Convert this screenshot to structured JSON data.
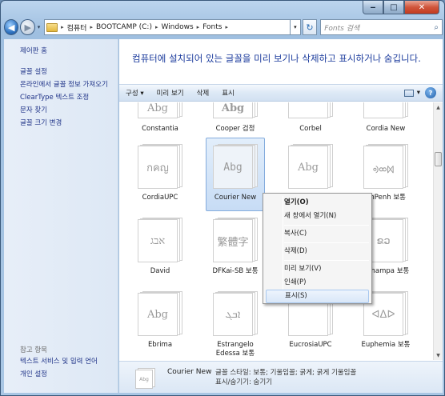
{
  "window": {
    "caption": {
      "minimize": "‒",
      "maximize": "□",
      "close": "✕"
    }
  },
  "nav": {
    "back_icon": "◀",
    "forward_icon": "▶",
    "breadcrumb": [
      "컴퓨터",
      "BOOTCAMP (C:)",
      "Windows",
      "Fonts"
    ],
    "search_placeholder": "Fonts 검색"
  },
  "left_pane": {
    "home": "제어판 홈",
    "links": [
      "글꼴 설정",
      "온라인에서 글꼴 정보 가져오기",
      "ClearType 텍스트 조정",
      "문자 찾기",
      "글꼴 크기 변경"
    ],
    "see_also_title": "참고 항목",
    "see_also": [
      "텍스트 서비스 및 입력 언어",
      "개인 설정"
    ]
  },
  "main": {
    "heading": "컴퓨터에 설치되어 있는 글꼴을 미리 보기나 삭제하고 표시하거나 숨깁니다.",
    "toolbar": {
      "organize": "구성 ▾",
      "preview": "미리 보기",
      "delete": "삭제",
      "show": "표시",
      "help": "?"
    },
    "fonts": [
      {
        "name": "Constantia",
        "sample": "Abg"
      },
      {
        "name": "Cooper 검정",
        "sample": "Abg"
      },
      {
        "name": "Corbel",
        "sample": ""
      },
      {
        "name": "Cordia New",
        "sample": ""
      },
      {
        "name": "CordiaUPC",
        "sample": "กคญ"
      },
      {
        "name": "Courier New",
        "sample": "Abg"
      },
      {
        "name": "",
        "sample": "Abg"
      },
      {
        "name": "unPenh 보통",
        "sample": "ᢀᢁᢂ"
      },
      {
        "name": "David",
        "sample": "אבג"
      },
      {
        "name": "DFKai-SB 보통",
        "sample": "繁體字"
      },
      {
        "name": "",
        "sample": ""
      },
      {
        "name": "kChampa 보통",
        "sample": "ຂວ"
      },
      {
        "name": "Ebrima",
        "sample": "Abg"
      },
      {
        "name": "Estrangelo Edessa 보통",
        "sample": "ܐܒܓ"
      },
      {
        "name": "EucrosiaUPC",
        "sample": ""
      },
      {
        "name": "Euphemia 보통",
        "sample": "ᐊᐃᐅ"
      }
    ]
  },
  "details": {
    "name": "Courier New",
    "style_line": "글꼴 스타일: 보통; 기울임꼴; 굵게; 굵게 기울임꼴",
    "visibility_line": "표시/숨기기: 숨기기",
    "thumb_sample": "Abg"
  },
  "context_menu": {
    "items": [
      "열기(O)",
      "새 창에서 열기(N)",
      "복사(C)",
      "삭제(D)",
      "미리 보기(V)",
      "인쇄(P)",
      "표시(S)"
    ]
  }
}
